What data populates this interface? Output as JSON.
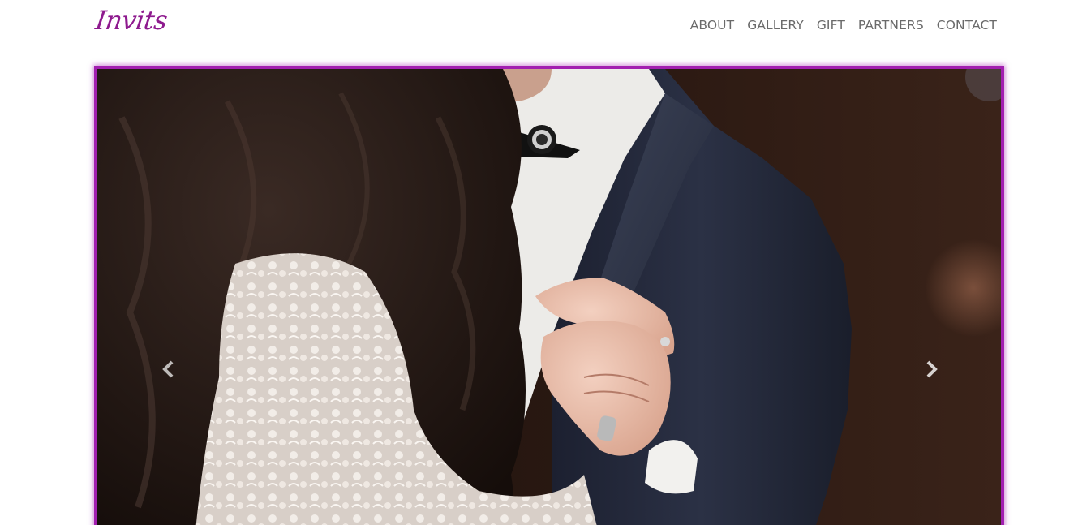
{
  "brand": {
    "name": "Invits",
    "color": "#8e1a8e"
  },
  "nav": {
    "items": [
      {
        "label": "ABOUT"
      },
      {
        "label": "GALLERY"
      },
      {
        "label": "GIFT"
      },
      {
        "label": "PARTNERS"
      },
      {
        "label": "CONTACT"
      }
    ]
  },
  "carousel": {
    "border_color": "#a21fb0",
    "prev_icon": "chevron-left-icon",
    "next_icon": "chevron-right-icon"
  }
}
